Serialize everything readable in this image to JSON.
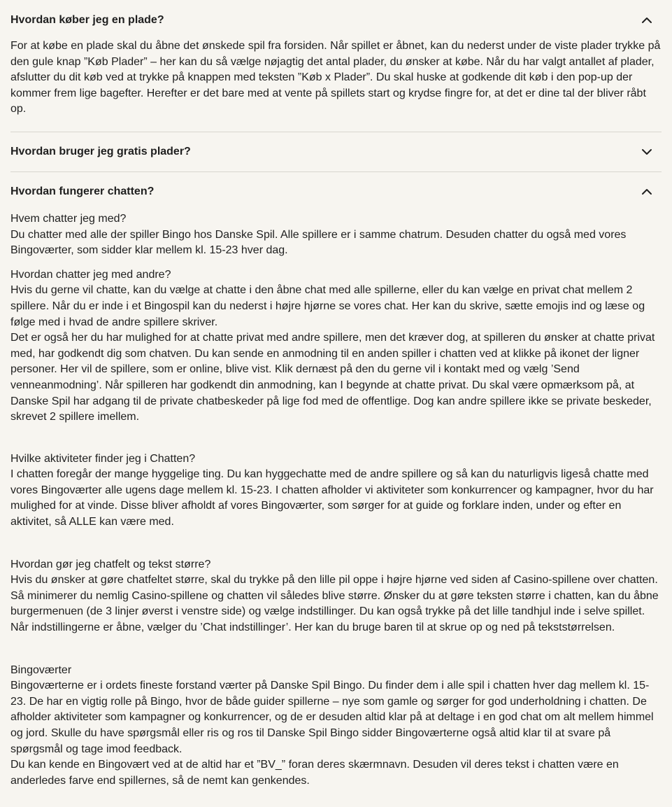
{
  "faq": [
    {
      "question": "Hvordan køber jeg en plade?",
      "expanded": true,
      "answer": "For at købe en plade skal du åbne det ønskede spil fra forsiden. Når spillet er åbnet, kan du nederst under de viste plader trykke på den gule knap ”Køb Plader” – her kan du så vælge nøjagtig det antal plader, du ønsker at købe. Når du har valgt antallet af plader, afslutter du dit køb ved at trykke på knappen med teksten ”Køb x Plader”. Du skal huske at godkende dit køb i den pop-up der kommer frem lige bagefter. Herefter er det bare med at vente på spillets start og krydse fingre for, at det er dine tal der bliver råbt op."
    },
    {
      "question": "Hvordan bruger jeg gratis plader?",
      "expanded": false
    },
    {
      "question": "Hvordan fungerer chatten?",
      "expanded": true,
      "sections": [
        {
          "heading": "Hvem chatter jeg med?",
          "lines": [
            "Du chatter med alle der spiller Bingo hos Danske Spil. Alle spillere er i samme chatrum. Desuden chatter du også med vores Bingoværter, som sidder klar mellem kl. 15-23 hver dag."
          ]
        },
        {
          "heading": "Hvordan chatter jeg med andre?",
          "lines": [
            "Hvis du gerne vil chatte, kan du vælge at chatte i den åbne chat med alle spillerne, eller du kan vælge en privat chat mellem 2 spillere. Når du er inde i et Bingospil kan du nederst i højre hjørne se vores chat. Her kan du skrive, sætte emojis ind og læse og følge med i hvad de andre spillere skriver.",
            "Det er også her du har mulighed for at chatte privat med andre spillere, men det kræver dog, at spilleren du ønsker at chatte privat med, har godkendt dig som chatven. Du kan sende en anmodning til en anden spiller i chatten ved at klikke på ikonet der ligner personer. Her vil de spillere, som er online, blive vist. Klik dernæst på den du gerne vil i kontakt med og vælg ’Send venneanmodning’. Når spilleren har godkendt din anmodning, kan I begynde at chatte privat. Du skal være opmærksom på, at Danske Spil har adgang til de private chatbeskeder på lige fod med de offentlige. Dog kan andre spillere ikke se private beskeder, skrevet 2 spillere imellem."
          ]
        },
        {
          "heading": "Hvilke aktiviteter finder jeg i Chatten?",
          "lines": [
            "I chatten foregår der mange hyggelige ting. Du kan hyggechatte med de andre spillere og så kan du naturligvis ligeså chatte med vores Bingoværter alle ugens dage mellem kl. 15-23. I chatten afholder vi aktiviteter som konkurrencer og kampagner, hvor du har mulighed for at vinde. Disse bliver afholdt af vores Bingoværter, som sørger for at guide og forklare inden, under og efter en aktivitet, så ALLE kan være med."
          ]
        },
        {
          "heading": "Hvordan gør jeg chatfelt og tekst større?",
          "lines": [
            "Hvis du ønsker at gøre chatfeltet større, skal du trykke på den lille pil oppe i højre hjørne ved siden af Casino-spillene over chatten. Så minimerer du nemlig Casino-spillene og chatten vil således blive større.  Ønsker du at gøre teksten større i chatten, kan du åbne burgermenuen (de 3 linjer øverst i venstre side) og vælge indstillinger. Du kan også trykke på det lille tandhjul inde i selve spillet. Når indstillingerne er åbne, vælger du ’Chat indstillinger’. Her kan du bruge baren til at skrue op og ned på tekststørrelsen."
          ]
        },
        {
          "heading": "Bingoværter",
          "lines": [
            "Bingoværterne er i ordets fineste forstand værter på Danske Spil Bingo. Du finder dem i alle spil i chatten hver dag mellem kl. 15-23. De har en vigtig rolle på Bingo, hvor de både guider spillerne – nye som gamle og sørger for god underholdning i chatten. De afholder aktiviteter som kampagner og konkurrencer, og de er desuden altid klar på at deltage i en god chat om alt mellem himmel og jord. Skulle du have spørgsmål eller ris og ros til Danske Spil Bingo sidder Bingoværterne også altid klar til at svare på spørgsmål og tage imod feedback.",
            "Du kan kende en Bingovært ved at de altid har et ”BV_” foran deres skærmnavn. Desuden vil deres tekst i chatten være en anderledes farve end spillernes, så de nemt kan genkendes."
          ]
        }
      ]
    }
  ],
  "icons": {
    "expanded": "chevron-up-icon",
    "collapsed": "chevron-down-icon"
  }
}
